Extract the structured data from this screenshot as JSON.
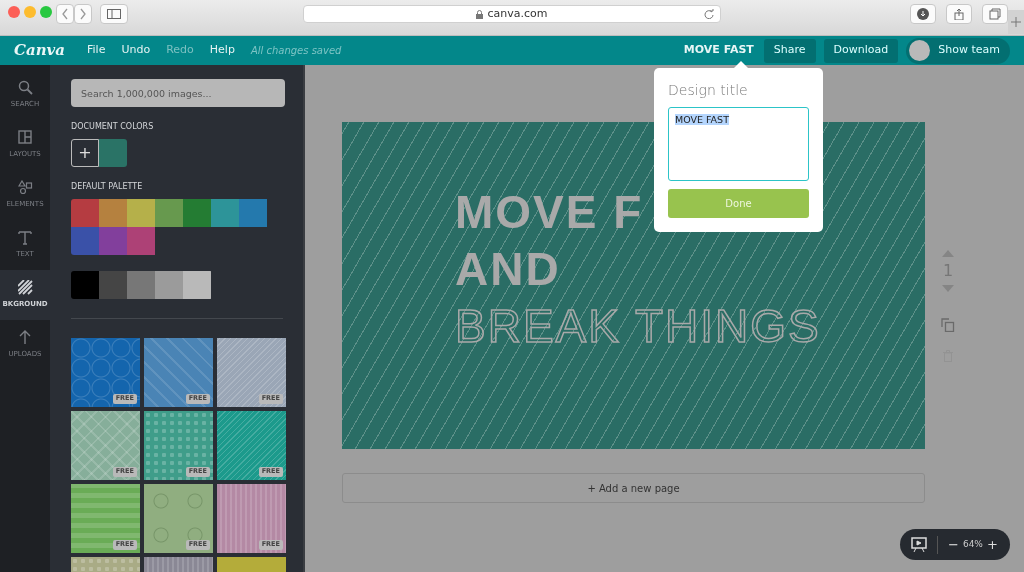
{
  "browser": {
    "url": "canva.com"
  },
  "toolbar": {
    "logo": "Canva",
    "menu": [
      {
        "label": "File",
        "disabled": false
      },
      {
        "label": "Undo",
        "disabled": false
      },
      {
        "label": "Redo",
        "disabled": true
      },
      {
        "label": "Help",
        "disabled": false
      }
    ],
    "save_status": "All changes saved",
    "design_name": "MOVE FAST",
    "buttons": [
      "Share",
      "Download"
    ],
    "team_toggle": {
      "label": "Show team",
      "on": false
    }
  },
  "sidebar": {
    "items": [
      {
        "label": "SEARCH",
        "selected": false
      },
      {
        "label": "LAYOUTS",
        "selected": false
      },
      {
        "label": "ELEMENTS",
        "selected": false
      },
      {
        "label": "TEXT",
        "selected": false
      },
      {
        "label": "BKGROUND",
        "selected": true
      },
      {
        "label": "UPLOADS",
        "selected": false
      }
    ]
  },
  "panel": {
    "search": {
      "placeholder": "Search 1,000,000 images..."
    },
    "document_colors": {
      "title": "DOCUMENT COLORS",
      "add": "+",
      "colors": [
        {
          "color": "#2a7366"
        }
      ]
    },
    "default_palette": {
      "title": "DEFAULT PALETTE",
      "colors": [
        {
          "color": "#b53c41"
        },
        {
          "color": "#b5813f"
        },
        {
          "color": "#b5b04a"
        },
        {
          "color": "#67994e"
        },
        {
          "color": "#247c33"
        },
        {
          "color": "#2d9499"
        },
        {
          "color": "#2479ad"
        },
        {
          "color": "#3a51a8"
        },
        {
          "color": "#823f9c"
        },
        {
          "color": "#ad4176"
        }
      ]
    },
    "grays": [
      {
        "color": "#000000"
      },
      {
        "color": "#454545"
      },
      {
        "color": "#777777"
      },
      {
        "color": "#9b9b9b"
      },
      {
        "color": "#b9b9b9"
      }
    ],
    "backgrounds": [
      {
        "kind": "hex",
        "color": "#1465ad",
        "badge": "FREE"
      },
      {
        "kind": "chevron",
        "color": "#4a84b5",
        "badge": "FREE"
      },
      {
        "kind": "diagonal",
        "color": "#9aa6b6",
        "badge": "FREE"
      },
      {
        "kind": "diamond",
        "color": "#86ae9a",
        "badge": "FREE"
      },
      {
        "kind": "dots",
        "color": "#3f9d8a",
        "badge": "FREE"
      },
      {
        "kind": "diagonal",
        "color": "#1c9a8c",
        "badge": "FREE"
      },
      {
        "kind": "hstripes",
        "color": "#6aac56",
        "badge": "FREE"
      },
      {
        "kind": "circles",
        "color": "#90ae80",
        "badge": "FREE"
      },
      {
        "kind": "vstripes",
        "color": "#b489a4",
        "badge": "FREE"
      },
      {
        "kind": "dots",
        "color": "#a9ab85"
      },
      {
        "kind": "vstripes",
        "color": "#8a8895"
      },
      {
        "kind": "plain",
        "color": "#b4ac3a"
      }
    ]
  },
  "design": {
    "lines": [
      {
        "text": "MOVE F",
        "kind": "solid"
      },
      {
        "text": "AND",
        "kind": "solid"
      },
      {
        "text": "BREAK THINGS",
        "kind": "outline"
      }
    ],
    "page_number": "1",
    "add_page": "+ Add a new page"
  },
  "zoom": {
    "minus": "−",
    "value": "64%",
    "plus": "+"
  },
  "popover": {
    "title": "Design title",
    "value": "MOVE FAST",
    "text_selected": true,
    "button": "Done"
  }
}
